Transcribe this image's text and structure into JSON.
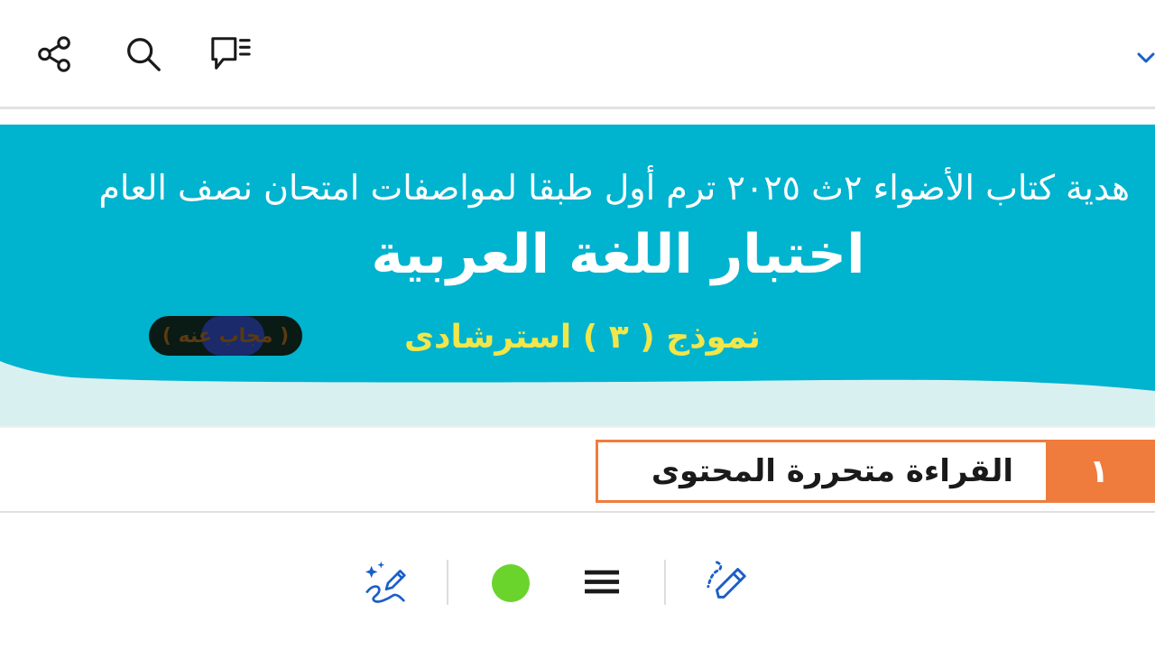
{
  "toolbar": {
    "icons": [
      "share-icon",
      "search-icon",
      "comments-icon",
      "chevron-down-icon"
    ],
    "accent": "#1a5fc8"
  },
  "banner": {
    "subtitle": "هدية كتاب الأضواء ٢ث ٢٠٢٥ ترم أول طبقا لمواصفات امتحان نصف العام",
    "title": "اختبار اللغة العربية",
    "model": "نموذج ( ٣ ) استرشادى",
    "answered_badge": "( مجاب عنه )",
    "colors": {
      "main": "#00b3cf",
      "wave": "#d9f0f1",
      "model_text": "#f1e64a"
    }
  },
  "section": {
    "number": "١",
    "title": "القراءة متحررة المحتوى",
    "accent": "#ef7c3c"
  },
  "bottom_toolbar": {
    "icons": [
      "sparkle-pen-icon",
      "color-dot",
      "menu-icon",
      "pen-icon"
    ],
    "dot_color": "#6ad42c"
  }
}
